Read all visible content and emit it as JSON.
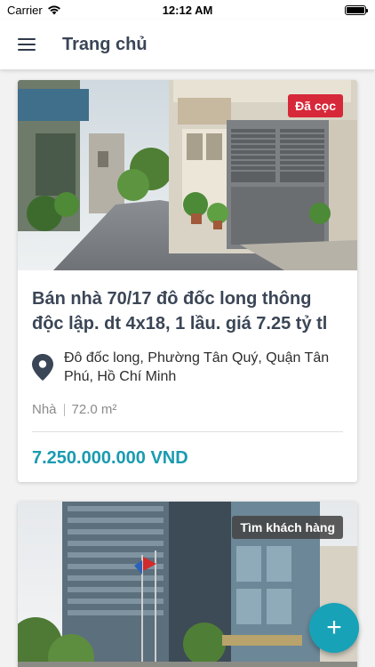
{
  "status_bar": {
    "carrier": "Carrier",
    "time": "12:12 AM"
  },
  "app_bar": {
    "title": "Trang chủ",
    "menu_icon": "hamburger-menu-icon"
  },
  "listings": [
    {
      "badge": "Đã cọc",
      "badge_color": "#d62839",
      "title": "Bán nhà 70/17 đô đốc long thông độc lập. dt 4x18, 1 lầu. giá 7.25 tỷ tl",
      "address": "Đô đốc long, Phường Tân Quý, Quận Tân Phú, Hồ Chí Minh",
      "type": "Nhà",
      "area": "72.0 m²",
      "price": "7.250.000.000 VND"
    },
    {
      "badge": "Tìm khách hàng"
    }
  ],
  "fab": {
    "label": "+",
    "color": "#17a2b8"
  },
  "colors": {
    "accent": "#17a2b8",
    "price": "#1a9bb0",
    "title": "#3b4656"
  }
}
